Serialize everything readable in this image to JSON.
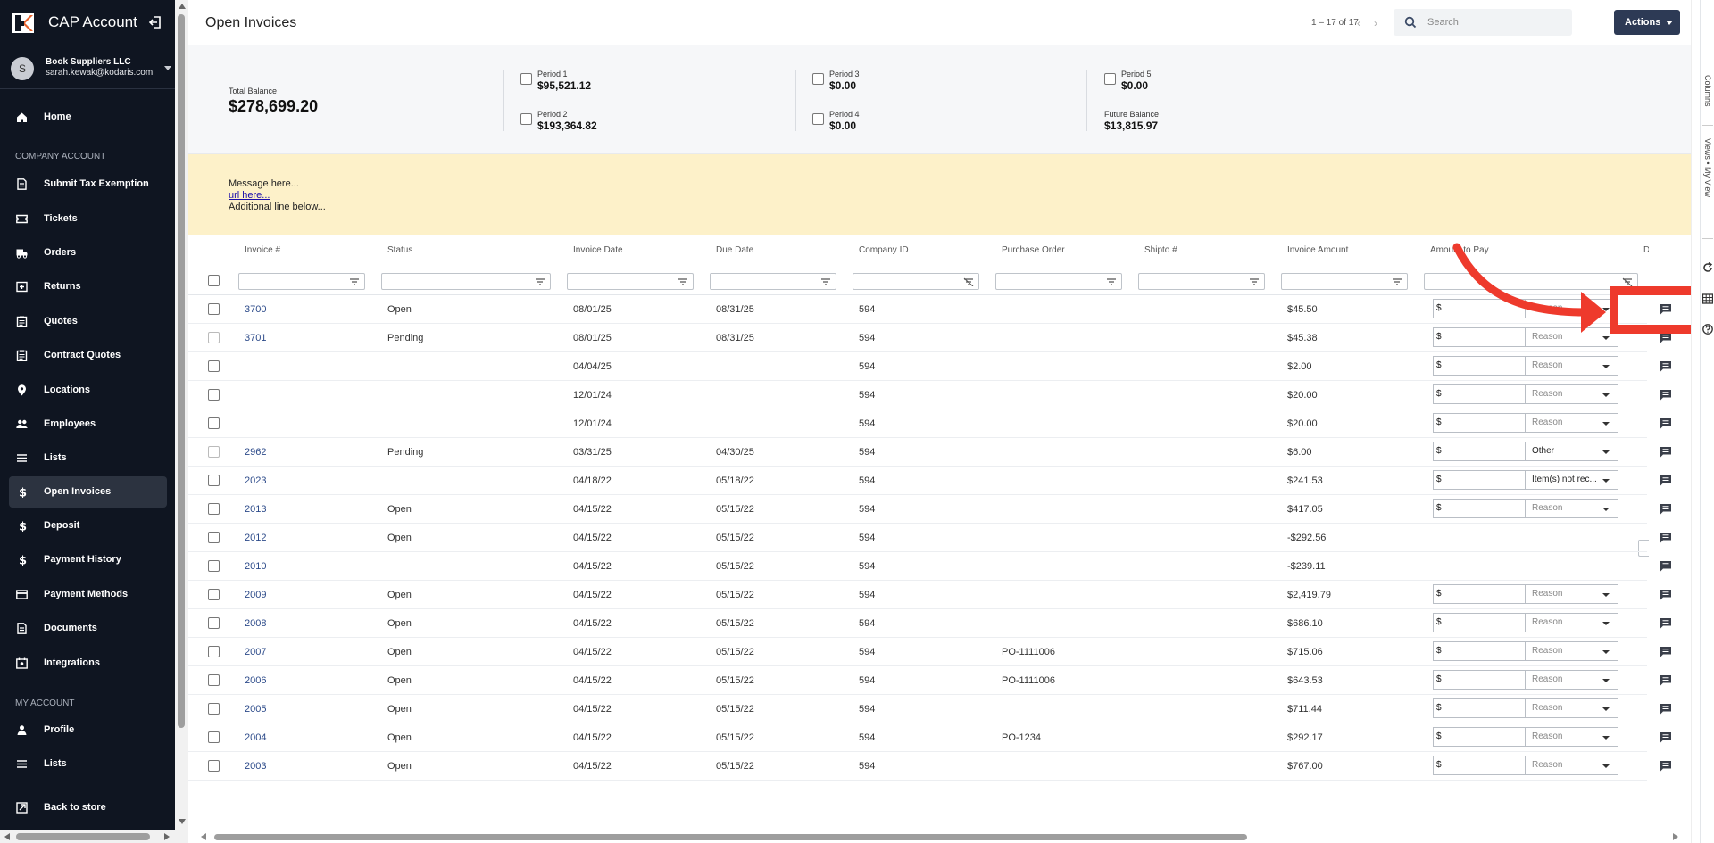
{
  "sidebar": {
    "app_title": "CAP Account",
    "user": {
      "initial": "S",
      "company": "Book Suppliers LLC",
      "email": "sarah.kewak@kodaris.com"
    },
    "section_company": "COMPANY ACCOUNT",
    "company_items": [
      {
        "label": "Home",
        "icon": "home-icon"
      },
      {
        "label": "Submit Tax Exemption",
        "icon": "document-icon"
      },
      {
        "label": "Tickets",
        "icon": "ticket-icon"
      },
      {
        "label": "Orders",
        "icon": "truck-icon"
      },
      {
        "label": "Returns",
        "icon": "return-icon"
      },
      {
        "label": "Quotes",
        "icon": "clipboard-icon"
      },
      {
        "label": "Contract Quotes",
        "icon": "clipboard-icon"
      },
      {
        "label": "Locations",
        "icon": "location-pin-icon"
      },
      {
        "label": "Employees",
        "icon": "people-icon"
      },
      {
        "label": "Lists",
        "icon": "list-icon"
      },
      {
        "label": "Open Invoices",
        "icon": "dollar-icon"
      },
      {
        "label": "Deposit",
        "icon": "dollar-icon"
      },
      {
        "label": "Payment History",
        "icon": "dollar-icon"
      },
      {
        "label": "Payment Methods",
        "icon": "credit-card-icon"
      },
      {
        "label": "Documents",
        "icon": "document-icon"
      },
      {
        "label": "Integrations",
        "icon": "integrations-icon"
      }
    ],
    "section_my": "MY ACCOUNT",
    "my_items": [
      {
        "label": "Profile",
        "icon": "person-icon"
      },
      {
        "label": "Lists",
        "icon": "list-icon"
      }
    ],
    "back_label": "Back to store",
    "active_item": "Open Invoices"
  },
  "header": {
    "title": "Open Invoices",
    "pager": "1 – 17 of 17",
    "search_placeholder": "Search",
    "actions_label": "Actions"
  },
  "summary": {
    "total_label": "Total Balance",
    "total_value": "$278,699.20",
    "periods": [
      {
        "label": "Period 1",
        "value": "$95,521.12"
      },
      {
        "label": "Period 2",
        "value": "$193,364.82"
      },
      {
        "label": "Period 3",
        "value": "$0.00"
      },
      {
        "label": "Period 4",
        "value": "$0.00"
      },
      {
        "label": "Period 5",
        "value": "$0.00"
      }
    ],
    "future_label": "Future Balance",
    "future_value": "$13,815.97"
  },
  "message": {
    "line1": "Message here...",
    "link": "url here...",
    "line3": "Additional line below..."
  },
  "table": {
    "headers": {
      "invoice": "Invoice #",
      "status": "Status",
      "invoice_date": "Invoice Date",
      "due_date": "Due Date",
      "company_id": "Company ID",
      "po": "Purchase Order",
      "shipto": "Shipto #",
      "amount": "Invoice Amount",
      "to_pay": "Amount to Pay",
      "d": "D"
    },
    "pay_prefix": "$",
    "rows": [
      {
        "invoice": "3700",
        "status": "Open",
        "invoice_date": "08/01/25",
        "due_date": "08/31/25",
        "company_id": "594",
        "po": "",
        "shipto": "",
        "amount": "$45.50",
        "payable": true,
        "reason": "Reason",
        "reason_set": false
      },
      {
        "invoice": "3701",
        "status": "Pending",
        "invoice_date": "08/01/25",
        "due_date": "08/31/25",
        "company_id": "594",
        "po": "",
        "shipto": "",
        "amount": "$45.38",
        "payable": true,
        "reason": "Reason",
        "reason_set": false
      },
      {
        "invoice": "",
        "status": "",
        "invoice_date": "04/04/25",
        "due_date": "",
        "company_id": "594",
        "po": "",
        "shipto": "",
        "amount": "$2.00",
        "payable": true,
        "reason": "Reason",
        "reason_set": false
      },
      {
        "invoice": "",
        "status": "",
        "invoice_date": "12/01/24",
        "due_date": "",
        "company_id": "594",
        "po": "",
        "shipto": "",
        "amount": "$20.00",
        "payable": true,
        "reason": "Reason",
        "reason_set": false
      },
      {
        "invoice": "",
        "status": "",
        "invoice_date": "12/01/24",
        "due_date": "",
        "company_id": "594",
        "po": "",
        "shipto": "",
        "amount": "$20.00",
        "payable": true,
        "reason": "Reason",
        "reason_set": false
      },
      {
        "invoice": "2962",
        "status": "Pending",
        "invoice_date": "03/31/25",
        "due_date": "04/30/25",
        "company_id": "594",
        "po": "",
        "shipto": "",
        "amount": "$6.00",
        "payable": true,
        "reason": "Other",
        "reason_set": true
      },
      {
        "invoice": "2023",
        "status": "",
        "invoice_date": "04/18/22",
        "due_date": "05/18/22",
        "company_id": "594",
        "po": "",
        "shipto": "",
        "amount": "$241.53",
        "payable": true,
        "reason": "Item(s) not rec...",
        "reason_set": true
      },
      {
        "invoice": "2013",
        "status": "Open",
        "invoice_date": "04/15/22",
        "due_date": "05/15/22",
        "company_id": "594",
        "po": "",
        "shipto": "",
        "amount": "$417.05",
        "payable": true,
        "reason": "Reason",
        "reason_set": false
      },
      {
        "invoice": "2012",
        "status": "Open",
        "invoice_date": "04/15/22",
        "due_date": "05/15/22",
        "company_id": "594",
        "po": "",
        "shipto": "",
        "amount": "-$292.56",
        "payable": false,
        "reason": "",
        "reason_set": false
      },
      {
        "invoice": "2010",
        "status": "",
        "invoice_date": "04/15/22",
        "due_date": "05/15/22",
        "company_id": "594",
        "po": "",
        "shipto": "",
        "amount": "-$239.11",
        "payable": false,
        "reason": "",
        "reason_set": false
      },
      {
        "invoice": "2009",
        "status": "Open",
        "invoice_date": "04/15/22",
        "due_date": "05/15/22",
        "company_id": "594",
        "po": "",
        "shipto": "",
        "amount": "$2,419.79",
        "payable": true,
        "reason": "Reason",
        "reason_set": false
      },
      {
        "invoice": "2008",
        "status": "Open",
        "invoice_date": "04/15/22",
        "due_date": "05/15/22",
        "company_id": "594",
        "po": "",
        "shipto": "",
        "amount": "$686.10",
        "payable": true,
        "reason": "Reason",
        "reason_set": false
      },
      {
        "invoice": "2007",
        "status": "Open",
        "invoice_date": "04/15/22",
        "due_date": "05/15/22",
        "company_id": "594",
        "po": "PO-1111006",
        "shipto": "",
        "amount": "$715.06",
        "payable": true,
        "reason": "Reason",
        "reason_set": false
      },
      {
        "invoice": "2006",
        "status": "Open",
        "invoice_date": "04/15/22",
        "due_date": "05/15/22",
        "company_id": "594",
        "po": "PO-1111006",
        "shipto": "",
        "amount": "$643.53",
        "payable": true,
        "reason": "Reason",
        "reason_set": false
      },
      {
        "invoice": "2005",
        "status": "Open",
        "invoice_date": "04/15/22",
        "due_date": "05/15/22",
        "company_id": "594",
        "po": "",
        "shipto": "",
        "amount": "$711.44",
        "payable": true,
        "reason": "Reason",
        "reason_set": false
      },
      {
        "invoice": "2004",
        "status": "Open",
        "invoice_date": "04/15/22",
        "due_date": "05/15/22",
        "company_id": "594",
        "po": "PO-1234",
        "shipto": "",
        "amount": "$292.17",
        "payable": true,
        "reason": "Reason",
        "reason_set": false
      },
      {
        "invoice": "2003",
        "status": "Open",
        "invoice_date": "04/15/22",
        "due_date": "05/15/22",
        "company_id": "594",
        "po": "",
        "shipto": "",
        "amount": "$767.00",
        "payable": true,
        "reason": "Reason",
        "reason_set": false
      }
    ]
  },
  "right_toolbar": {
    "columns_label": "Columns",
    "views_label": "Views • My View"
  },
  "colors": {
    "sidebar_bg": "#0f1521",
    "active_item_bg": "#2c3340",
    "actions_bg": "#2d3a55",
    "message_bg": "#fdf1c9",
    "annotation": "#ee3a2c"
  }
}
